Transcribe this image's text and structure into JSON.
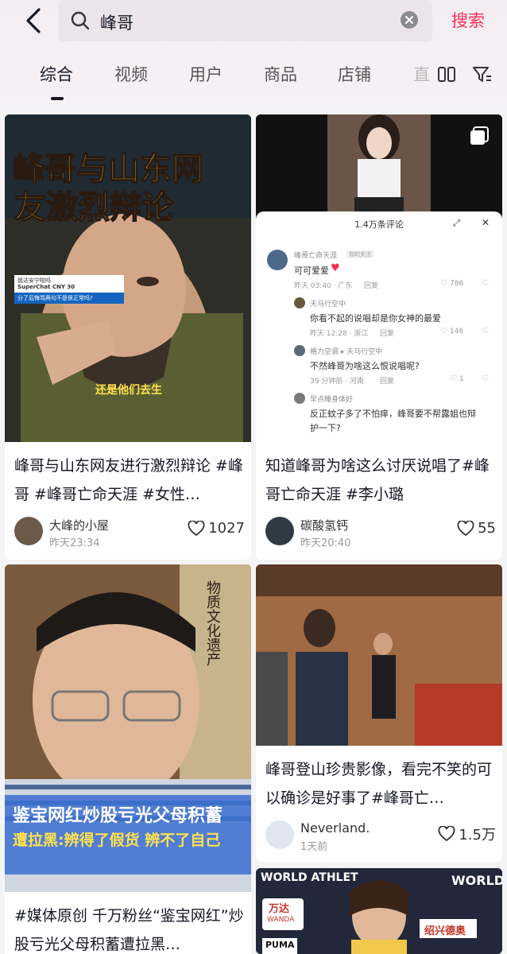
{
  "search": {
    "query": "峰哥",
    "submit_label": "搜索"
  },
  "tabs": [
    {
      "label": "综合"
    },
    {
      "label": "视频"
    },
    {
      "label": "用户"
    },
    {
      "label": "商品"
    },
    {
      "label": "店铺"
    },
    {
      "label": "直"
    }
  ],
  "cards": [
    {
      "title": "峰哥与山东网友进行激烈辩论 #峰哥 #峰哥亡命天涯 #女性…",
      "author": "大峰的小屋",
      "time": "昨天23:34",
      "likes": "1027",
      "thumb_headline_1": "峰哥与山东网",
      "thumb_headline_2": "友激烈辩论",
      "thumb_caption": "还是他们去生",
      "thumb_chat_1": "姐达安宁啦吗",
      "thumb_chat_2": "SuperChat CNY 30",
      "thumb_chat_3": "分了后悔骂两句不是很正常吗?"
    },
    {
      "title": "知道峰哥为啥这么讨厌说唱了#峰哥亡命天涯 #李小璐",
      "author": "碳酸氢钙",
      "time": "昨天20:40",
      "likes": "55",
      "panel_title": "1.4万条评论",
      "c1_name": "峰哥亡命天涯",
      "c1_tag": "你的关注",
      "c1_text": "可可爱爱",
      "c1_meta": "昨天 03:40 · 广东",
      "c1_reply": "回复",
      "c1_likes": "786",
      "c2_name": "天马行空中",
      "c2_text": "你看不起的说唱却是你女神的最爱",
      "c2_meta": "昨天 12:28 · 浙江",
      "c2_reply": "回复",
      "c2_likes": "146",
      "c3_name": "格力空调 ▸ 天马行空中",
      "c3_text": "不然峰哥为啥这么恨说唱呢?",
      "c3_meta": "39 分钟前 · 河南",
      "c3_reply": "回复",
      "c3_likes": "1",
      "c4_name": "早点睡身体好",
      "c4_text_1": "反正蚊子多了不怕痒，峰哥要不帮露姐也辩",
      "c4_text_2": "护一下?"
    },
    {
      "title": "#媒体原创 千万粉丝“鉴宝网红”炒股亏光父母积蓄遭拉黑…",
      "thumb_line_1": "鉴宝网红炒股亏光父母积蓄",
      "thumb_line_2": "遭拉黑:辨得了假货 辨不了自己",
      "thumb_side": "物质文化遗产"
    },
    {
      "title": "峰哥登山珍贵影像，看完不笑的可以确诊是好事了#峰哥亡…",
      "author": "Neverland.",
      "time": "1天前",
      "likes": "1.5万"
    },
    {
      "thumb_text_1": "WORLD ATHLET",
      "thumb_text_2": "WORLD",
      "thumb_text_3": "万达",
      "thumb_text_4": "WANDA",
      "thumb_text_5": "绍兴德奥",
      "thumb_text_6": "PUMA"
    }
  ],
  "colors": {
    "accent": "#fe2c55",
    "header_bg": "#f3edf2",
    "page_bg": "#f4f4f6"
  }
}
